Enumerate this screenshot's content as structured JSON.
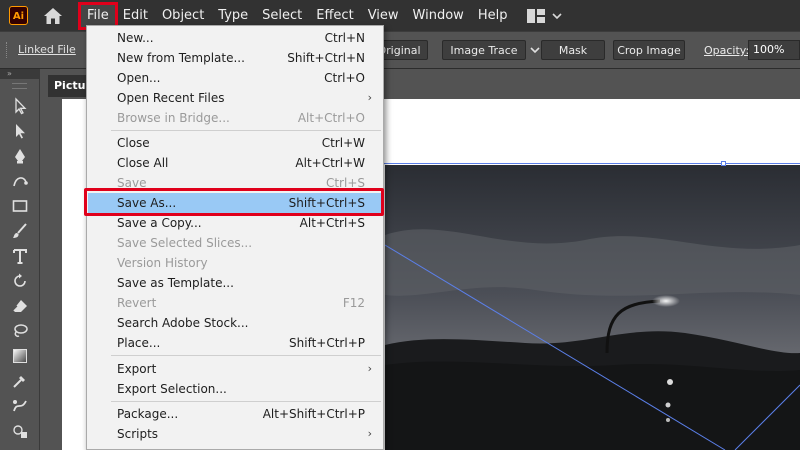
{
  "app": {
    "logo_text": "Ai"
  },
  "menubar": {
    "items": [
      "File",
      "Edit",
      "Object",
      "Type",
      "Select",
      "Effect",
      "View",
      "Window",
      "Help"
    ],
    "active_index": 0
  },
  "controlbar": {
    "linked_file": "Linked File",
    "original_label": "Original",
    "image_trace": "Image Trace",
    "mask": "Mask",
    "crop_image": "Crop Image",
    "opacity_label": "Opacity:",
    "opacity_value": "100%"
  },
  "document": {
    "tab_label": "Pictur",
    "toolbar_head": "»"
  },
  "file_menu": {
    "items": [
      {
        "label": "New...",
        "shortcut": "Ctrl+N",
        "disabled": false
      },
      {
        "label": "New from Template...",
        "shortcut": "Shift+Ctrl+N",
        "disabled": false
      },
      {
        "label": "Open...",
        "shortcut": "Ctrl+O",
        "disabled": false
      },
      {
        "label": "Open Recent Files",
        "shortcut": "",
        "submenu": true,
        "disabled": false
      },
      {
        "label": "Browse in Bridge...",
        "shortcut": "Alt+Ctrl+O",
        "disabled": true
      },
      {
        "label": "Close",
        "shortcut": "Ctrl+W",
        "disabled": false
      },
      {
        "label": "Close All",
        "shortcut": "Alt+Ctrl+W",
        "disabled": false
      },
      {
        "label": "Save",
        "shortcut": "Ctrl+S",
        "disabled": true
      },
      {
        "label": "Save As...",
        "shortcut": "Shift+Ctrl+S",
        "disabled": false,
        "highlighted": true
      },
      {
        "label": "Save a Copy...",
        "shortcut": "Alt+Ctrl+S",
        "disabled": false
      },
      {
        "label": "Save Selected Slices...",
        "shortcut": "",
        "disabled": true
      },
      {
        "label": "Version History",
        "shortcut": "",
        "disabled": true
      },
      {
        "label": "Save as Template...",
        "shortcut": "",
        "disabled": false
      },
      {
        "label": "Revert",
        "shortcut": "F12",
        "disabled": true
      },
      {
        "label": "Search Adobe Stock...",
        "shortcut": "",
        "disabled": false
      },
      {
        "label": "Place...",
        "shortcut": "Shift+Ctrl+P",
        "disabled": false
      },
      {
        "label": "Export",
        "shortcut": "",
        "submenu": true,
        "disabled": false
      },
      {
        "label": "Export Selection...",
        "shortcut": "",
        "disabled": false
      },
      {
        "label": "Package...",
        "shortcut": "Alt+Shift+Ctrl+P",
        "disabled": false
      },
      {
        "label": "Scripts",
        "shortcut": "",
        "submenu": true,
        "disabled": false
      }
    ],
    "submenu_glyph": "›"
  },
  "colors": {
    "highlight": "#99c9f5",
    "callout_red": "#e0001b",
    "selection_blue": "#5b7fe8",
    "menubar_bg": "#323232",
    "panel_bg": "#535353"
  }
}
